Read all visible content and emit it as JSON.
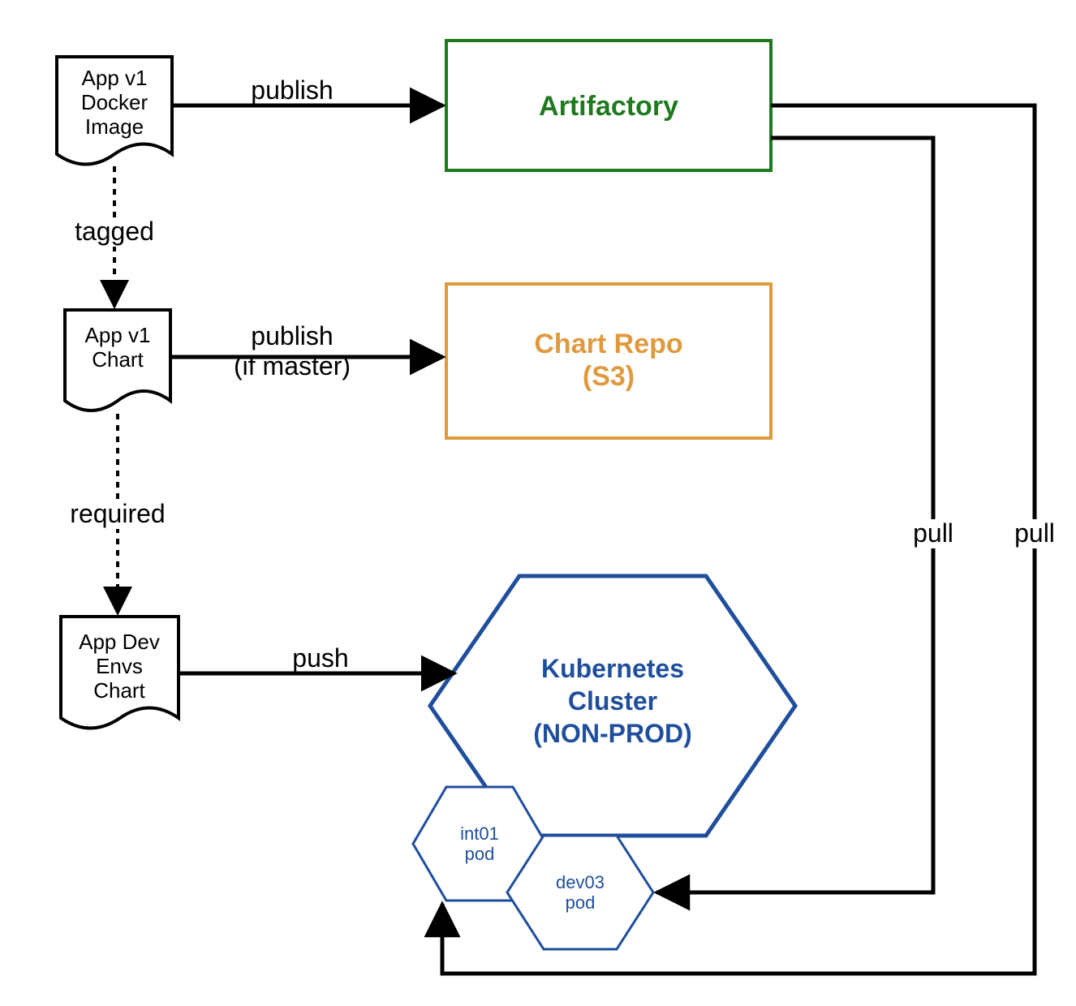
{
  "nodes": {
    "docker_image": {
      "line1": "App v1",
      "line2": "Docker",
      "line3": "Image"
    },
    "app_chart": {
      "line1": "App v1",
      "line2": "Chart"
    },
    "dev_envs": {
      "line1": "App Dev",
      "line2": "Envs",
      "line3": "Chart"
    },
    "artifactory": {
      "title": "Artifactory",
      "color": "#1f7a1f"
    },
    "chart_repo": {
      "line1": "Chart Repo",
      "line2": "(S3)",
      "color": "#e09a3e"
    },
    "k8s": {
      "line1": "Kubernetes",
      "line2": "Cluster",
      "line3": "(NON-PROD)",
      "color": "#1f4e9c"
    },
    "int01": {
      "line1": "int01",
      "line2": "pod"
    },
    "dev03": {
      "line1": "dev03",
      "line2": "pod"
    }
  },
  "edges": {
    "publish1": "publish",
    "publish2_l1": "publish",
    "publish2_l2": "(if master)",
    "push": "push",
    "tagged": "tagged",
    "required": "required",
    "pull1": "pull",
    "pull2": "pull"
  }
}
